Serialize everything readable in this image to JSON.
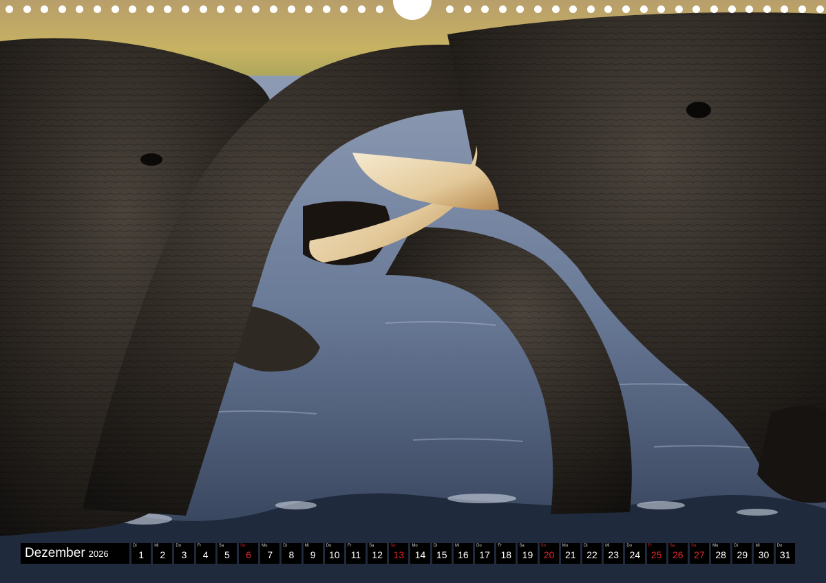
{
  "calendar": {
    "month": "Dezember",
    "year": "2026",
    "days": [
      {
        "wd": "Di",
        "d": "1"
      },
      {
        "wd": "Mi",
        "d": "2"
      },
      {
        "wd": "Do",
        "d": "3"
      },
      {
        "wd": "Fr",
        "d": "4"
      },
      {
        "wd": "Sa",
        "d": "5"
      },
      {
        "wd": "So",
        "d": "6",
        "red": true
      },
      {
        "wd": "Mo",
        "d": "7"
      },
      {
        "wd": "Di",
        "d": "8"
      },
      {
        "wd": "Mi",
        "d": "9"
      },
      {
        "wd": "Do",
        "d": "10"
      },
      {
        "wd": "Fr",
        "d": "11"
      },
      {
        "wd": "Sa",
        "d": "12"
      },
      {
        "wd": "So",
        "d": "13",
        "red": true
      },
      {
        "wd": "Mo",
        "d": "14"
      },
      {
        "wd": "Di",
        "d": "15"
      },
      {
        "wd": "Mi",
        "d": "16"
      },
      {
        "wd": "Do",
        "d": "17"
      },
      {
        "wd": "Fr",
        "d": "18"
      },
      {
        "wd": "Sa",
        "d": "19"
      },
      {
        "wd": "So",
        "d": "20",
        "red": true
      },
      {
        "wd": "Mo",
        "d": "21"
      },
      {
        "wd": "Di",
        "d": "22"
      },
      {
        "wd": "Mi",
        "d": "23"
      },
      {
        "wd": "Do",
        "d": "24"
      },
      {
        "wd": "Fr",
        "d": "25",
        "red": true
      },
      {
        "wd": "Sa",
        "d": "26",
        "red": true
      },
      {
        "wd": "So",
        "d": "27",
        "red": true
      },
      {
        "wd": "Mo",
        "d": "28"
      },
      {
        "wd": "Di",
        "d": "29"
      },
      {
        "wd": "Mi",
        "d": "30"
      },
      {
        "wd": "Do",
        "d": "31"
      }
    ]
  },
  "colors": {
    "holiday": "#e0262b",
    "cell": "#000000",
    "water": "#5d6f8a",
    "elephant_skin": "#2a2622",
    "tusk": "#e8d2a8",
    "savanna": "#c9b25e"
  },
  "photo": {
    "subject": "two elephants wrestling with trunks in water"
  }
}
